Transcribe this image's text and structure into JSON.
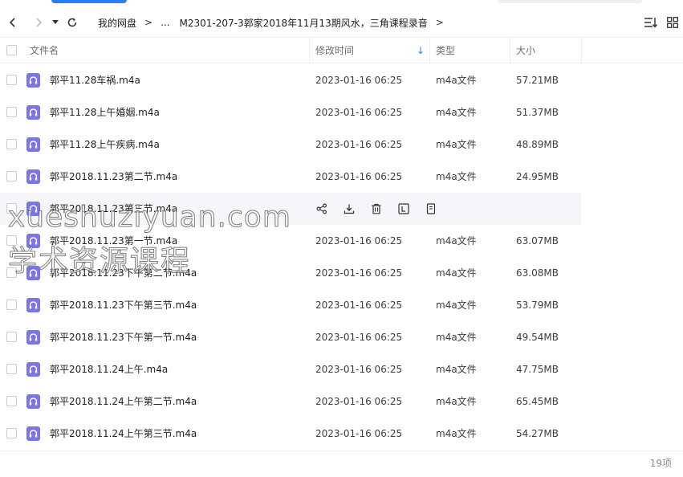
{
  "toolbar": {
    "breadcrumb": {
      "root": "我的网盘",
      "sep1": ">",
      "ellipsis": "...",
      "current": "M2301-207-3郭家2018年11月13期风水，三角课程录音",
      "sep2": ">"
    },
    "icons": {
      "back": "chevron-left-icon",
      "forward": "chevron-right-icon",
      "history": "dropdown-caret-icon",
      "refresh": "refresh-icon",
      "sort": "sort-icon",
      "view": "grid-view-icon"
    }
  },
  "table": {
    "headers": {
      "name": "文件名",
      "modified": "修改时间",
      "type": "类型",
      "size": "大小"
    },
    "sort_indicator": "↓",
    "rows": [
      {
        "name": "郭平11.28车祸.m4a",
        "modified": "2023-01-16 06:25",
        "type": "m4a文件",
        "size": "57.21MB"
      },
      {
        "name": "郭平11.28上午婚姻.m4a",
        "modified": "2023-01-16 06:25",
        "type": "m4a文件",
        "size": "51.37MB"
      },
      {
        "name": "郭平11.28上午疾病.m4a",
        "modified": "2023-01-16 06:25",
        "type": "m4a文件",
        "size": "48.89MB"
      },
      {
        "name": "郭平2018.11.23第二节.m4a",
        "modified": "2023-01-16 06:25",
        "type": "m4a文件",
        "size": "24.95MB"
      },
      {
        "name": "郭平2018.11.23第三节.m4a",
        "hovered": true
      },
      {
        "name": "郭平2018.11.23第一节.m4a",
        "modified": "2023-01-16 06:25",
        "type": "m4a文件",
        "size": "63.07MB"
      },
      {
        "name": "郭平2018.11.23下午第二节.m4a",
        "modified": "2023-01-16 06:25",
        "type": "m4a文件",
        "size": "63.08MB"
      },
      {
        "name": "郭平2018.11.23下午第三节.m4a",
        "modified": "2023-01-16 06:25",
        "type": "m4a文件",
        "size": "53.79MB"
      },
      {
        "name": "郭平2018.11.23下午第一节.m4a",
        "modified": "2023-01-16 06:25",
        "type": "m4a文件",
        "size": "49.54MB"
      },
      {
        "name": "郭平2018.11.24上午.m4a",
        "modified": "2023-01-16 06:25",
        "type": "m4a文件",
        "size": "47.75MB"
      },
      {
        "name": "郭平2018.11.24上午第二节.m4a",
        "modified": "2023-01-16 06:25",
        "type": "m4a文件",
        "size": "65.45MB"
      },
      {
        "name": "郭平2018.11.24上午第三节.m4a",
        "modified": "2023-01-16 06:25",
        "type": "m4a文件",
        "size": "54.27MB"
      }
    ],
    "hover_actions": [
      "share-icon",
      "download-icon",
      "delete-icon",
      "rename-icon",
      "more-icon"
    ]
  },
  "footer": {
    "item_count": "19项"
  },
  "watermark": {
    "line1": "xueshuziyuan.com",
    "line2": "学术资源课程"
  },
  "colors": {
    "accent": "#2a7fff",
    "file_icon": "#7b74e8",
    "hover_row": "#f5f6f9",
    "border": "#eceef2"
  }
}
